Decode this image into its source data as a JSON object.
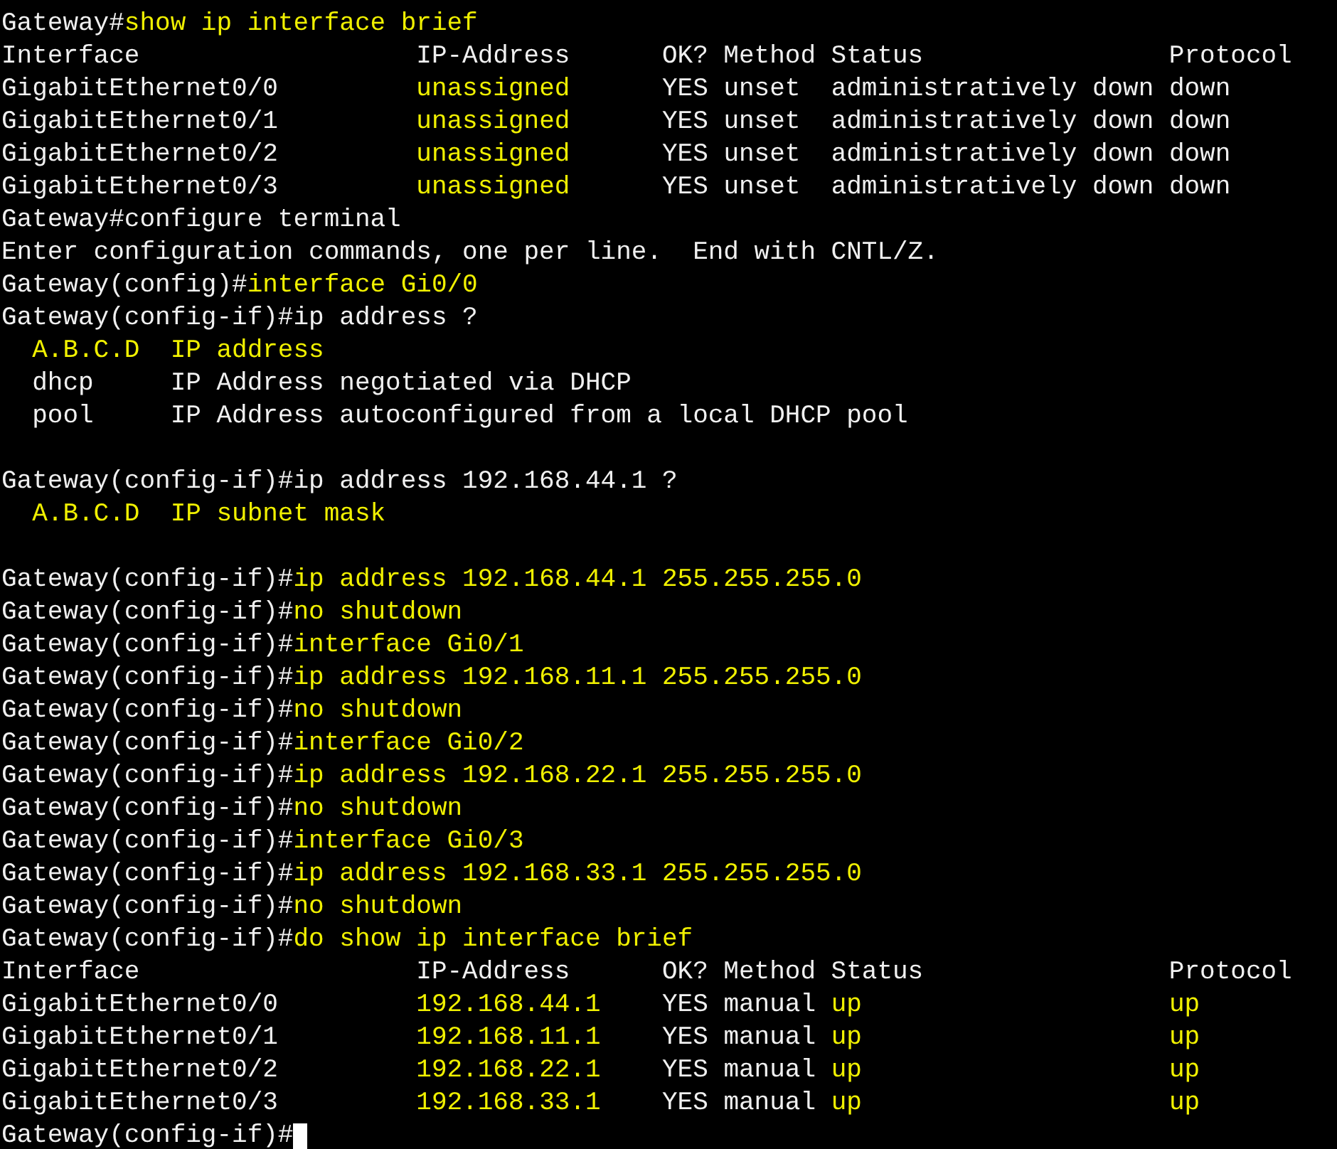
{
  "terminal": {
    "lines": [
      {
        "kind": "text",
        "segments": [
          {
            "text": "Gateway#",
            "kind": "normal"
          },
          {
            "text": "show ip interface brief",
            "kind": "highlight"
          }
        ]
      },
      {
        "kind": "text",
        "segments": [
          {
            "text": "Interface                  IP-Address      OK? Method Status                Protocol",
            "kind": "normal"
          }
        ]
      },
      {
        "kind": "text",
        "segments": [
          {
            "text": "GigabitEthernet0/0         ",
            "kind": "normal"
          },
          {
            "text": "unassigned",
            "kind": "highlight"
          },
          {
            "text": "      YES unset  administratively down down",
            "kind": "normal"
          }
        ]
      },
      {
        "kind": "text",
        "segments": [
          {
            "text": "GigabitEthernet0/1         ",
            "kind": "normal"
          },
          {
            "text": "unassigned",
            "kind": "highlight"
          },
          {
            "text": "      YES unset  administratively down down",
            "kind": "normal"
          }
        ]
      },
      {
        "kind": "text",
        "segments": [
          {
            "text": "GigabitEthernet0/2         ",
            "kind": "normal"
          },
          {
            "text": "unassigned",
            "kind": "highlight"
          },
          {
            "text": "      YES unset  administratively down down",
            "kind": "normal"
          }
        ]
      },
      {
        "kind": "text",
        "segments": [
          {
            "text": "GigabitEthernet0/3         ",
            "kind": "normal"
          },
          {
            "text": "unassigned",
            "kind": "highlight"
          },
          {
            "text": "      YES unset  administratively down down",
            "kind": "normal"
          }
        ]
      },
      {
        "kind": "text",
        "segments": [
          {
            "text": "Gateway#configure terminal",
            "kind": "normal"
          }
        ]
      },
      {
        "kind": "text",
        "segments": [
          {
            "text": "Enter configuration commands, one per line.  End with CNTL/Z.",
            "kind": "normal"
          }
        ]
      },
      {
        "kind": "text",
        "segments": [
          {
            "text": "Gateway(config)#",
            "kind": "normal"
          },
          {
            "text": "interface Gi0/0",
            "kind": "highlight"
          }
        ]
      },
      {
        "kind": "text",
        "segments": [
          {
            "text": "Gateway(config-if)#ip address ?",
            "kind": "normal"
          }
        ]
      },
      {
        "kind": "text",
        "segments": [
          {
            "text": "  A.B.C.D  IP address",
            "kind": "highlight"
          }
        ]
      },
      {
        "kind": "text",
        "segments": [
          {
            "text": "  dhcp     IP Address negotiated via DHCP",
            "kind": "normal"
          }
        ]
      },
      {
        "kind": "text",
        "segments": [
          {
            "text": "  pool     IP Address autoconfigured from a local DHCP pool",
            "kind": "normal"
          }
        ]
      },
      {
        "kind": "blank"
      },
      {
        "kind": "text",
        "segments": [
          {
            "text": "Gateway(config-if)#ip address 192.168.44.1 ?",
            "kind": "normal"
          }
        ]
      },
      {
        "kind": "text",
        "segments": [
          {
            "text": "  A.B.C.D  IP subnet mask",
            "kind": "highlight"
          }
        ]
      },
      {
        "kind": "blank"
      },
      {
        "kind": "text",
        "segments": [
          {
            "text": "Gateway(config-if)#",
            "kind": "normal"
          },
          {
            "text": "ip address 192.168.44.1 255.255.255.0",
            "kind": "highlight"
          }
        ]
      },
      {
        "kind": "text",
        "segments": [
          {
            "text": "Gateway(config-if)#",
            "kind": "normal"
          },
          {
            "text": "no shutdown",
            "kind": "highlight"
          }
        ]
      },
      {
        "kind": "text",
        "segments": [
          {
            "text": "Gateway(config-if)#",
            "kind": "normal"
          },
          {
            "text": "interface Gi0/1",
            "kind": "highlight"
          }
        ]
      },
      {
        "kind": "text",
        "segments": [
          {
            "text": "Gateway(config-if)#",
            "kind": "normal"
          },
          {
            "text": "ip address 192.168.11.1 255.255.255.0",
            "kind": "highlight"
          }
        ]
      },
      {
        "kind": "text",
        "segments": [
          {
            "text": "Gateway(config-if)#",
            "kind": "normal"
          },
          {
            "text": "no shutdown",
            "kind": "highlight"
          }
        ]
      },
      {
        "kind": "text",
        "segments": [
          {
            "text": "Gateway(config-if)#",
            "kind": "normal"
          },
          {
            "text": "interface Gi0/2",
            "kind": "highlight"
          }
        ]
      },
      {
        "kind": "text",
        "segments": [
          {
            "text": "Gateway(config-if)#",
            "kind": "normal"
          },
          {
            "text": "ip address 192.168.22.1 255.255.255.0",
            "kind": "highlight"
          }
        ]
      },
      {
        "kind": "text",
        "segments": [
          {
            "text": "Gateway(config-if)#",
            "kind": "normal"
          },
          {
            "text": "no shutdown",
            "kind": "highlight"
          }
        ]
      },
      {
        "kind": "text",
        "segments": [
          {
            "text": "Gateway(config-if)#",
            "kind": "normal"
          },
          {
            "text": "interface Gi0/3",
            "kind": "highlight"
          }
        ]
      },
      {
        "kind": "text",
        "segments": [
          {
            "text": "Gateway(config-if)#",
            "kind": "normal"
          },
          {
            "text": "ip address 192.168.33.1 255.255.255.0",
            "kind": "highlight"
          }
        ]
      },
      {
        "kind": "text",
        "segments": [
          {
            "text": "Gateway(config-if)#",
            "kind": "normal"
          },
          {
            "text": "no shutdown",
            "kind": "highlight"
          }
        ]
      },
      {
        "kind": "text",
        "segments": [
          {
            "text": "Gateway(config-if)#",
            "kind": "normal"
          },
          {
            "text": "do show ip interface brief",
            "kind": "highlight"
          }
        ]
      },
      {
        "kind": "text",
        "segments": [
          {
            "text": "Interface                  IP-Address      OK? Method Status                Protocol",
            "kind": "normal"
          }
        ]
      },
      {
        "kind": "text",
        "segments": [
          {
            "text": "GigabitEthernet0/0         ",
            "kind": "normal"
          },
          {
            "text": "192.168.44.1",
            "kind": "highlight"
          },
          {
            "text": "    YES manual ",
            "kind": "normal"
          },
          {
            "text": "up                    up",
            "kind": "highlight"
          }
        ]
      },
      {
        "kind": "text",
        "segments": [
          {
            "text": "GigabitEthernet0/1         ",
            "kind": "normal"
          },
          {
            "text": "192.168.11.1",
            "kind": "highlight"
          },
          {
            "text": "    YES manual ",
            "kind": "normal"
          },
          {
            "text": "up                    up",
            "kind": "highlight"
          }
        ]
      },
      {
        "kind": "text",
        "segments": [
          {
            "text": "GigabitEthernet0/2         ",
            "kind": "normal"
          },
          {
            "text": "192.168.22.1",
            "kind": "highlight"
          },
          {
            "text": "    YES manual ",
            "kind": "normal"
          },
          {
            "text": "up                    up",
            "kind": "highlight"
          }
        ]
      },
      {
        "kind": "text",
        "segments": [
          {
            "text": "GigabitEthernet0/3         ",
            "kind": "normal"
          },
          {
            "text": "192.168.33.1",
            "kind": "highlight"
          },
          {
            "text": "    YES manual ",
            "kind": "normal"
          },
          {
            "text": "up                    up",
            "kind": "highlight"
          }
        ]
      },
      {
        "kind": "prompt",
        "segments": [
          {
            "text": "Gateway(config-if)#",
            "kind": "normal"
          }
        ]
      }
    ]
  }
}
